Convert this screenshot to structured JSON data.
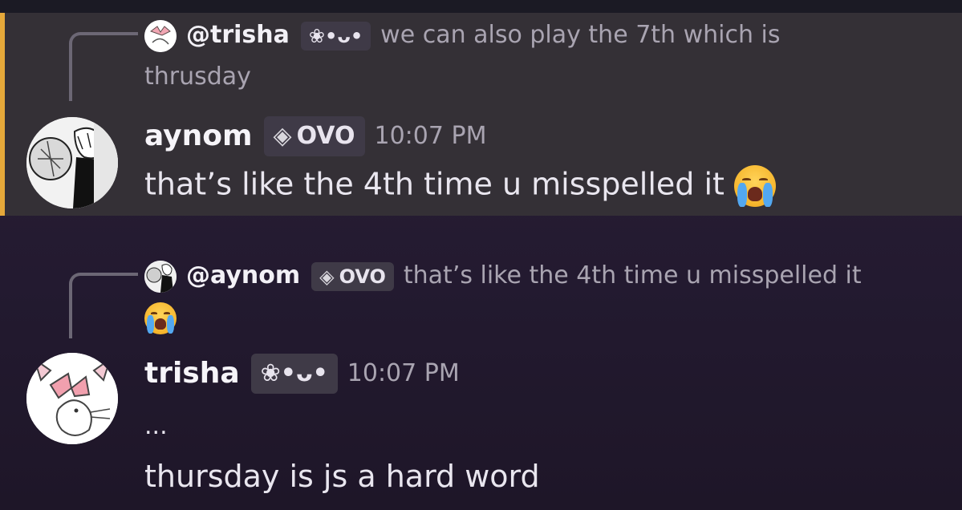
{
  "colors": {
    "accent": "#e5a83a",
    "highlight_bg": "#343036",
    "tag_bg": "#3f3a47",
    "muted_text": "#a9a4b1"
  },
  "messages": [
    {
      "reply": {
        "avatar_icon": "bunny-bow-avatar",
        "name": "@trisha",
        "tag": "❀•ᴗ•",
        "text": "we can also play the 7th which is",
        "text_wrap": "thrusday"
      },
      "avatar_icon": "manga-character-avatar",
      "author": "aynom",
      "tag": "OVO",
      "tag_icon": "gem-icon",
      "time": "10:07 PM",
      "text": "that’s like the 4th time u misspelled it",
      "emoji": "loudly-crying-face"
    },
    {
      "reply": {
        "avatar_icon": "manga-character-avatar",
        "name": "@aynom",
        "tag": "OVO",
        "tag_icon": "gem-icon",
        "text": "that’s like the 4th time u misspelled it",
        "emoji": "loudly-crying-face"
      },
      "avatar_icon": "bunny-bow-avatar",
      "author": "trisha",
      "tag": "❀•ᴗ•",
      "time": "10:07 PM",
      "lines": [
        "...",
        "thursday is js a hard word"
      ]
    }
  ]
}
